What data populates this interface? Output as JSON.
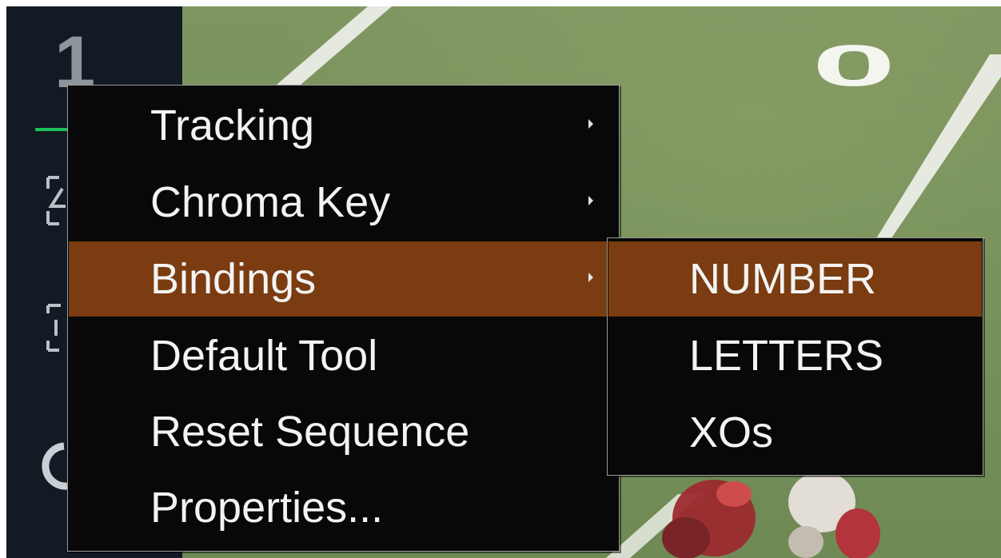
{
  "side_panel": {
    "layer_number": "1"
  },
  "context_menu": {
    "items": [
      {
        "label": "Tracking",
        "has_submenu": true
      },
      {
        "label": "Chroma Key",
        "has_submenu": true
      },
      {
        "label": "Bindings",
        "has_submenu": true,
        "highlighted": true
      },
      {
        "label": "Default Tool",
        "has_submenu": false
      },
      {
        "label": "Reset Sequence",
        "has_submenu": false
      },
      {
        "label": "Properties...",
        "has_submenu": false
      }
    ]
  },
  "bindings_submenu": {
    "items": [
      {
        "label": "NUMBER",
        "highlighted": true
      },
      {
        "label": "LETTERS"
      },
      {
        "label": "XOs"
      }
    ]
  },
  "field": {
    "yard_marker": "0"
  },
  "colors": {
    "highlight": "#7a3c10",
    "menu_bg": "#080808",
    "panel_bg": "#121a24",
    "accent_green": "#1fc25a"
  }
}
